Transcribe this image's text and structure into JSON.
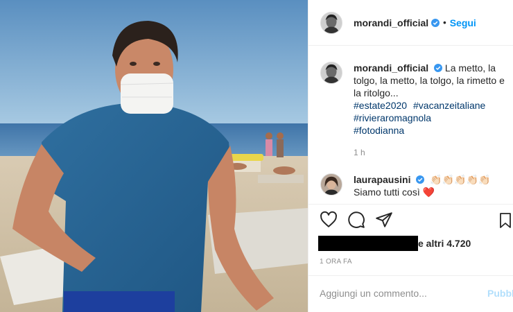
{
  "post": {
    "author": "morandi_official",
    "follow_label": "Segui",
    "dot": "•",
    "caption_text": "La metto, la tolgo, la metto, la tolgo, la rimetto e la ritolgo...",
    "hashtags": [
      "#estate2020",
      "#vacanzeitaliane",
      "#rivieraromagnola",
      "#fotodianna"
    ],
    "caption_time": "1 h"
  },
  "comment": {
    "author": "laurapausini",
    "emoji": "👏🏻👏🏻👏🏻👏🏻👏🏻",
    "text": "Siamo tutti così ❤️"
  },
  "likes": {
    "others_text": "e altri 4.720"
  },
  "timestamp": "1 ORA FA",
  "add_comment": {
    "placeholder": "Aggiungi un commento...",
    "publish_label": "Pubblica"
  },
  "icons": {
    "like": "heart-icon",
    "comment": "comment-icon",
    "share": "share-icon",
    "save": "bookmark-icon",
    "verified": "verified-badge-icon"
  },
  "colors": {
    "accent": "#0095f6",
    "hashtag": "#00376b",
    "muted": "#8e8e8e",
    "publish_disabled": "#b2dffc",
    "verified": "#3897f0",
    "heart": "#e0245e"
  }
}
